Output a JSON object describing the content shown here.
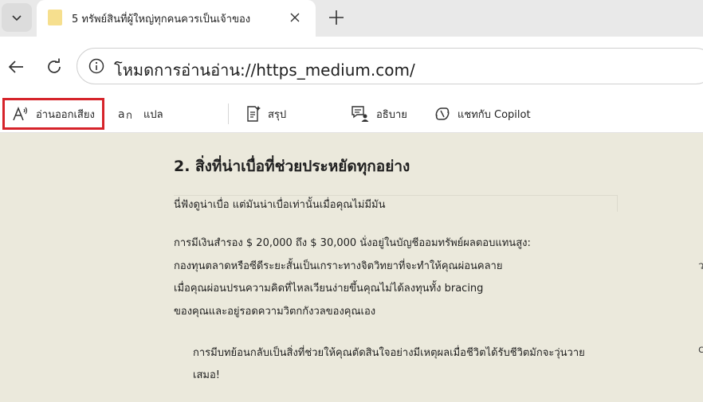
{
  "browser": {
    "tab": {
      "title": "5 ทรัพย์สินที่ผู้ใหญ่ทุกคนควรเป็นเจ้าของ"
    },
    "address": {
      "text": "โหมดการอ่านอ่าน://https_medium.com/"
    }
  },
  "toolbar": {
    "read_aloud": "อ่านออกเสียง",
    "translate": "แปล",
    "summarize": "สรุป",
    "explain": "อธิบาย",
    "copilot": "แชทกับ Copilot"
  },
  "article": {
    "heading": "2. สิ่งที่น่าเบื่อที่ช่วยประหยัดทุกอย่าง",
    "subheading": "นี่ฟังดูน่าเบื่อ แต่มันน่าเบื่อเท่านั้นเมื่อคุณไม่มีมัน",
    "paragraph_lines": [
      "การมีเงินสำรอง $ 20,000 ถึง $ 30,000 นั่งอยู่ในบัญชีออมทรัพย์ผลตอบแทนสูง:",
      "กองทุนตลาดหรือซีดีระยะสั้นเป็นเกราะทางจิตวิทยาที่จะทำให้คุณผ่อนคลาย",
      "เมื่อคุณผ่อนปรนความคิดที่ไหลเวียนง่ายขึ้นคุณไม่ได้ลงทุนทั้ง bracing",
      "ของคุณและอยู่รอดความวิตกกังวลของคุณเอง"
    ],
    "quote_lines": [
      "การมีบทย้อนกลับเป็นสิ่งที่ช่วยให้คุณตัดสินใจอย่างมีเหตุผลเมื่อชีวิตได้รับชีวิตมักจะวุ่นวาย",
      "เสมอ!"
    ],
    "edge_marks": [
      "ว",
      "c"
    ]
  }
}
